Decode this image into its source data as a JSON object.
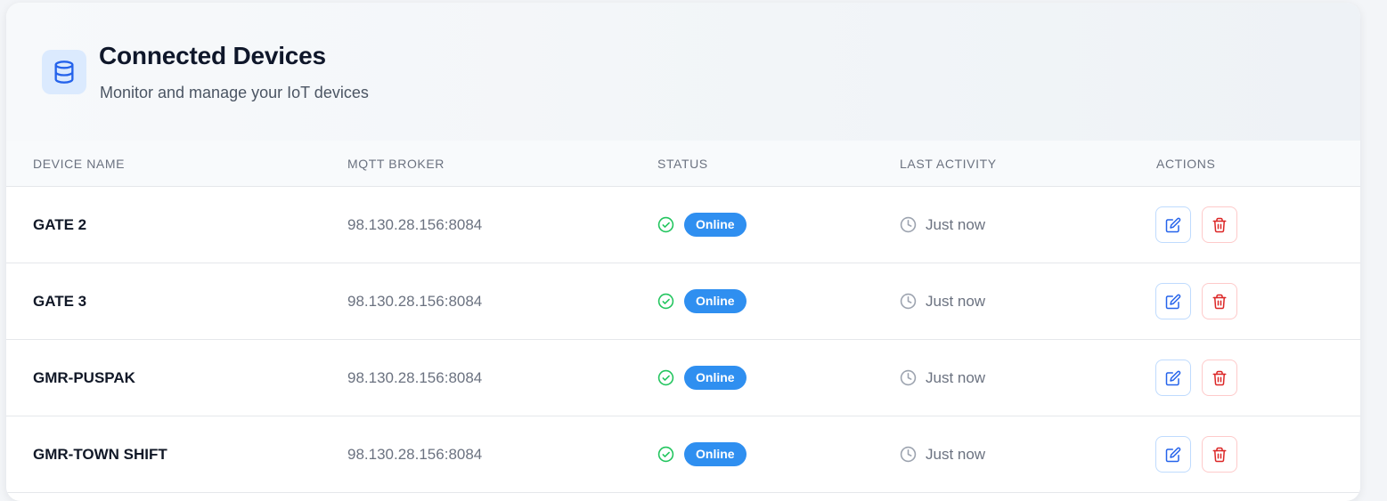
{
  "header": {
    "title": "Connected Devices",
    "subtitle": "Monitor and manage your IoT devices",
    "icon": "database-icon"
  },
  "table": {
    "columns": [
      "DEVICE NAME",
      "MQTT BROKER",
      "STATUS",
      "LAST ACTIVITY",
      "ACTIONS"
    ],
    "rows": [
      {
        "name": "GATE 2",
        "broker": "98.130.28.156:8084",
        "status": "Online",
        "activity": "Just now"
      },
      {
        "name": "GATE 3",
        "broker": "98.130.28.156:8084",
        "status": "Online",
        "activity": "Just now"
      },
      {
        "name": "GMR-PUSPAK",
        "broker": "98.130.28.156:8084",
        "status": "Online",
        "activity": "Just now"
      },
      {
        "name": "GMR-TOWN SHIFT",
        "broker": "98.130.28.156:8084",
        "status": "Online",
        "activity": "Just now"
      }
    ]
  },
  "icons": {
    "status": "check-circle-icon",
    "activity": "clock-icon",
    "edit": "edit-icon",
    "delete": "trash-icon"
  },
  "colors": {
    "accent": "#2563eb",
    "online_badge": "#2f8ff0",
    "success": "#22c55e",
    "danger": "#dc2626"
  }
}
